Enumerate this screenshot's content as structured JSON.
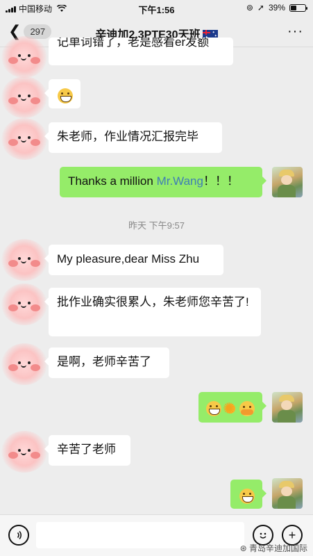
{
  "status_bar": {
    "carrier": "中国移动",
    "time": "下午1:56",
    "battery_percent": "39%",
    "battery_level": 0.39
  },
  "nav": {
    "back_count": "297",
    "title": "辛迪加2.3PTE30天班"
  },
  "messages": [
    {
      "side": "left",
      "text": "记单词错了，老是感看er发额"
    },
    {
      "side": "left",
      "emoji": "grin-icon"
    },
    {
      "side": "left",
      "text": "朱老师，作业情况汇报完毕"
    },
    {
      "side": "right",
      "text_prefix": "Thanks a million ",
      "mention": "Mr.Wang",
      "text_suffix": "！！！"
    },
    {
      "side": "left",
      "text": "My pleasure,dear Miss Zhu"
    },
    {
      "side": "left",
      "text": "批作业确实很累人，朱老师您辛苦了!"
    },
    {
      "side": "left",
      "text": "是啊，老师辛苦了"
    },
    {
      "side": "right",
      "emojis": [
        "grin-icon",
        "sun-icon",
        "hug-icon"
      ]
    },
    {
      "side": "left",
      "text": "辛苦了老师"
    },
    {
      "side": "right",
      "emoji": "grin-icon"
    }
  ],
  "timestamp": "昨天 下午9:57",
  "input_bar": {
    "voice_icon": "voice-icon",
    "emoji_icon": "emoji-icon",
    "plus_icon": "plus-icon"
  },
  "watermark": "青岛辛迪加国际",
  "colors": {
    "background": "#ededed",
    "bubble_self": "#95ec69",
    "bubble_other": "#ffffff",
    "mention": "#3f7eb5"
  }
}
